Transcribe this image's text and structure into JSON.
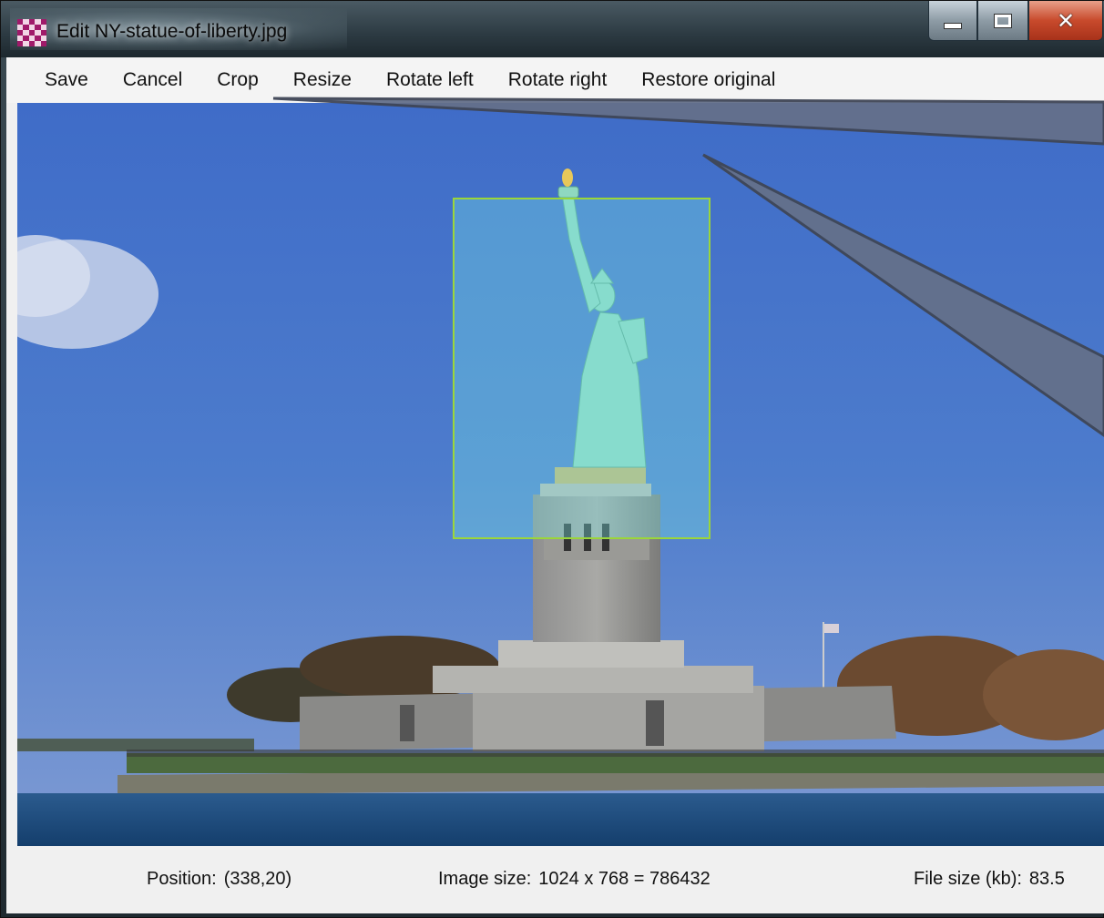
{
  "window": {
    "title": "Edit NY-statue-of-liberty.jpg",
    "caption_buttons": {
      "minimize": "minimize-icon",
      "maximize": "maximize-icon",
      "close": "close-icon"
    }
  },
  "menu": {
    "items": [
      "Save",
      "Cancel",
      "Crop",
      "Resize",
      "Rotate left",
      "Rotate right",
      "Restore original"
    ]
  },
  "status": {
    "position_label": "Position:",
    "position_value": "(338,20)",
    "image_size_label": "Image size:",
    "image_size_value": "1024 x 768 = 786432",
    "file_size_label": "File size (kb):",
    "file_size_value": "83.5"
  },
  "colors": {
    "crop_border": "#9bd63a",
    "sky": "#4a72c4",
    "close_button": "#c84a2c"
  }
}
